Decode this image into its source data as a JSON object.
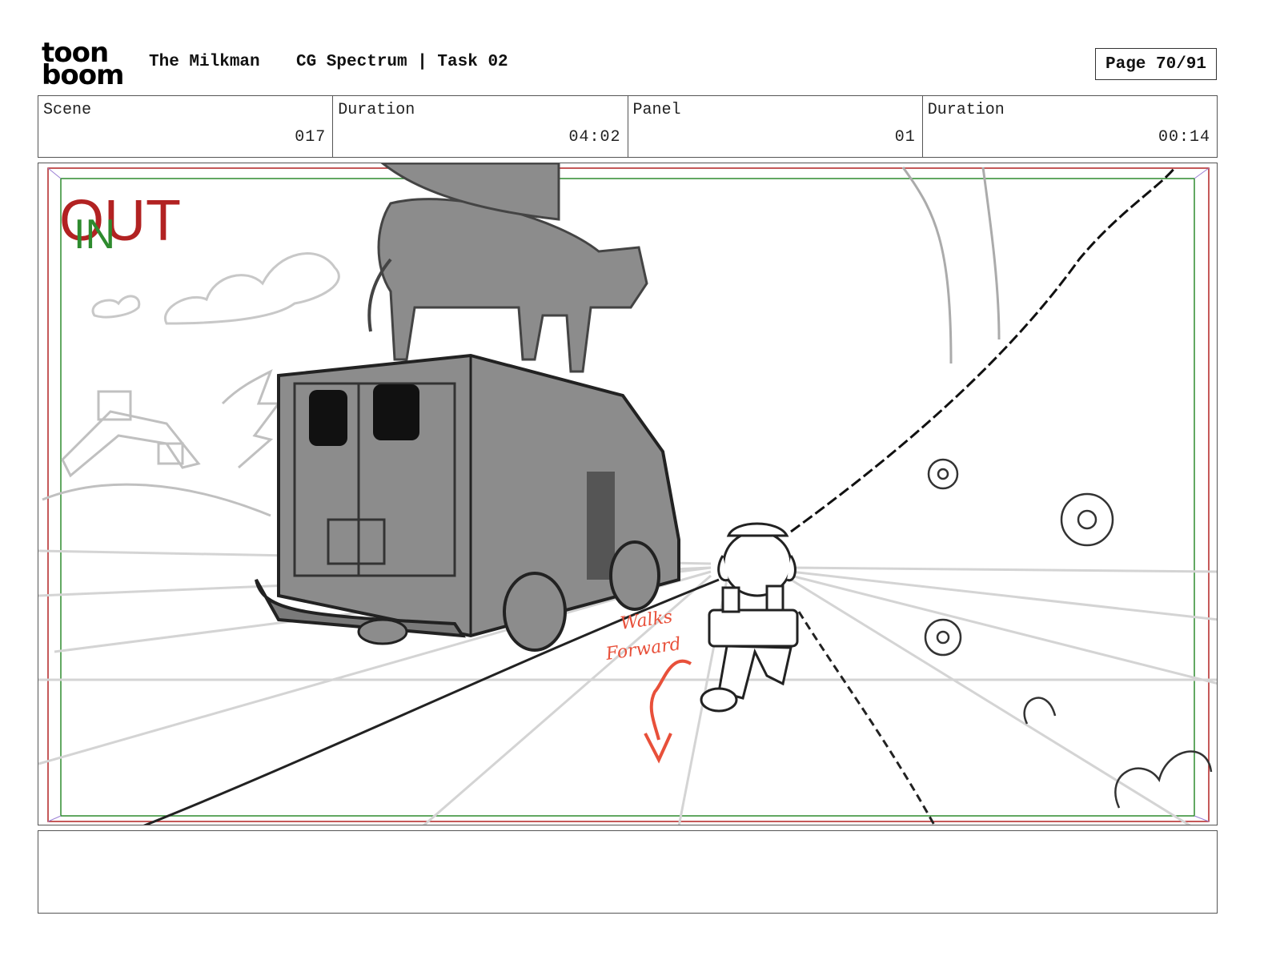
{
  "header": {
    "logo_line1": "toon",
    "logo_line2": "boom",
    "project_title": "The Milkman",
    "project_subtitle": "CG Spectrum | Task 02",
    "page_label": "Page 70/91"
  },
  "info": {
    "scene_label": "Scene",
    "scene_value": "017",
    "scene_duration_label": "Duration",
    "scene_duration_value": "04:02",
    "panel_label": "Panel",
    "panel_value": "01",
    "panel_duration_label": "Duration",
    "panel_duration_value": "00:14"
  },
  "panel": {
    "out_marker": "OUT",
    "in_marker": "IN",
    "annotation_line1": "Walks",
    "annotation_line2": "Forward"
  },
  "colors": {
    "out_frame": "#b22222",
    "in_frame": "#2e8b2e",
    "annotation": "#e8503a",
    "sketch_fill": "#8c8c8c"
  },
  "notes": {
    "text": ""
  }
}
